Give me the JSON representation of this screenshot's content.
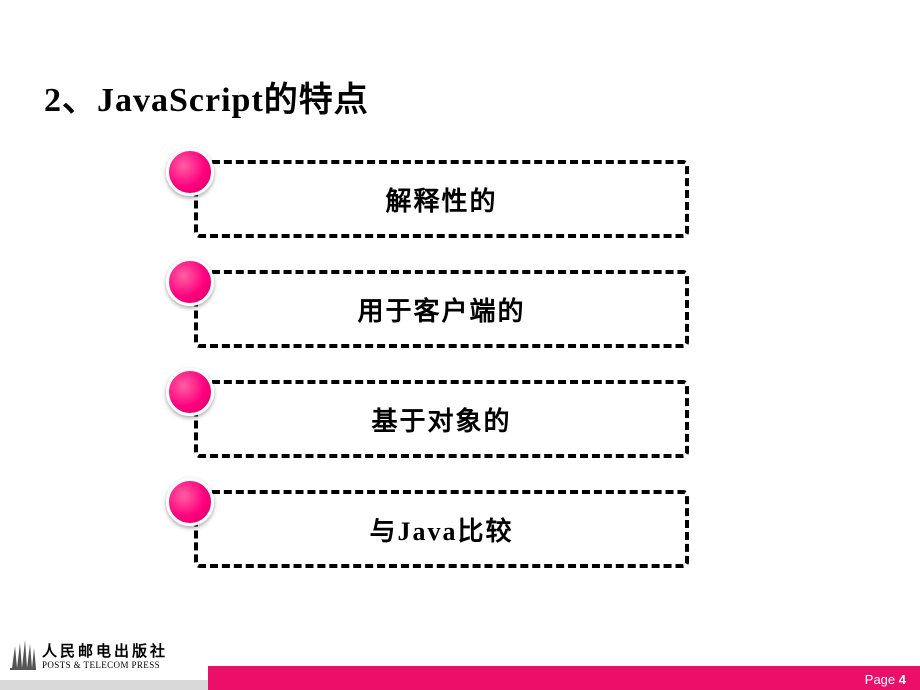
{
  "title": "2、JavaScript的特点",
  "items": [
    {
      "label": "解释性的"
    },
    {
      "label": "用于客户端的"
    },
    {
      "label": "基于对象的"
    },
    {
      "label": "与Java比较"
    }
  ],
  "publisher": {
    "cn": "人民邮电出版社",
    "en": "POSTS & TELECOM PRESS"
  },
  "footer": {
    "page_label": "Page ",
    "page_number": "4"
  },
  "colors": {
    "accent": "#ec0f6a",
    "dot": "#ff007f"
  }
}
